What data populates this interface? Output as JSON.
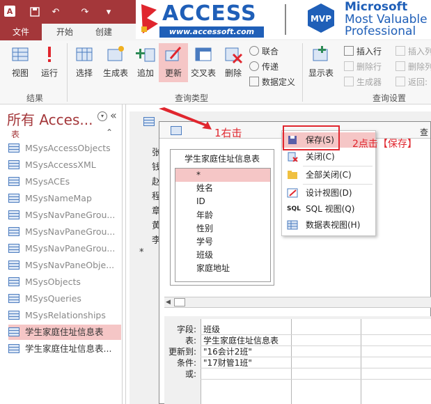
{
  "colors": {
    "accent": "#a4373a",
    "highlight": "#f5c6c6",
    "annotation": "#e0262e",
    "brand_blue": "#1f5fb8"
  },
  "qat": {
    "app_icon": "A"
  },
  "tabs": {
    "file": "文件",
    "home": "开始",
    "create": "创建"
  },
  "watermark": {
    "access_title": "ACCESS",
    "access_url": "www.accessoft.com",
    "mvp_badge": "MVP",
    "mvp_line1": "Microsoft",
    "mvp_line2": "Most Valuable",
    "mvp_line3": "Professional"
  },
  "ribbon": {
    "view": "视图",
    "run": "运行",
    "group_results": "结果",
    "select": "选择",
    "make_table": "生成表",
    "append": "追加",
    "update": "更新",
    "crosstab": "交叉表",
    "delete": "删除",
    "union": "联合",
    "passthrough": "传递",
    "data_definition": "数据定义",
    "group_query_type": "查询类型",
    "show_table": "显示表",
    "insert_rows": "插入行",
    "delete_rows": "删除行",
    "builder": "生成器",
    "insert_cols": "插入列",
    "delete_cols": "删除列",
    "return": "返回:",
    "group_query_setup": "查询设置"
  },
  "nav": {
    "header": "所有 Acces...",
    "section": "表",
    "items": [
      "MSysAccessObjects",
      "MSysAccessXML",
      "MSysACEs",
      "MSysNameMap",
      "MSysNavPaneGrou...",
      "MSysNavPaneGrou...",
      "MSysNavPaneGrou...",
      "MSysNavPaneObje...",
      "MSysObjects",
      "MSysQueries",
      "MSysRelationships",
      "学生家庭住址信息表",
      "学生家庭住址信息表..."
    ]
  },
  "background_sheet": {
    "cells": [
      "张",
      "钱",
      "赵",
      "程",
      "章",
      "黄",
      "李",
      "*"
    ]
  },
  "query": {
    "title_right": "查",
    "field_list_title": "学生家庭住址信息表",
    "fields": [
      "*",
      "姓名",
      "ID",
      "年龄",
      "性别",
      "学号",
      "班级",
      "家庭地址"
    ]
  },
  "qbe": {
    "labels": {
      "field": "字段:",
      "table": "表:",
      "update_to": "更新到:",
      "criteria": "条件:",
      "or": "或:"
    },
    "values": {
      "field": "班级",
      "table": "学生家庭住址信息表",
      "update_to": "\"16会计2班\"",
      "criteria": "\"17财管1班\""
    }
  },
  "context_menu": {
    "save": "保存(S)",
    "close": "关闭(C)",
    "close_all": "全部关闭(C)",
    "design_view": "设计视图(D)",
    "sql_view": "SQL 视图(Q)",
    "datasheet_view": "数据表视图(H)",
    "sql_icon_text": "SQL"
  },
  "annotations": {
    "step1": "1右击",
    "step2": "2点击【保存】"
  }
}
